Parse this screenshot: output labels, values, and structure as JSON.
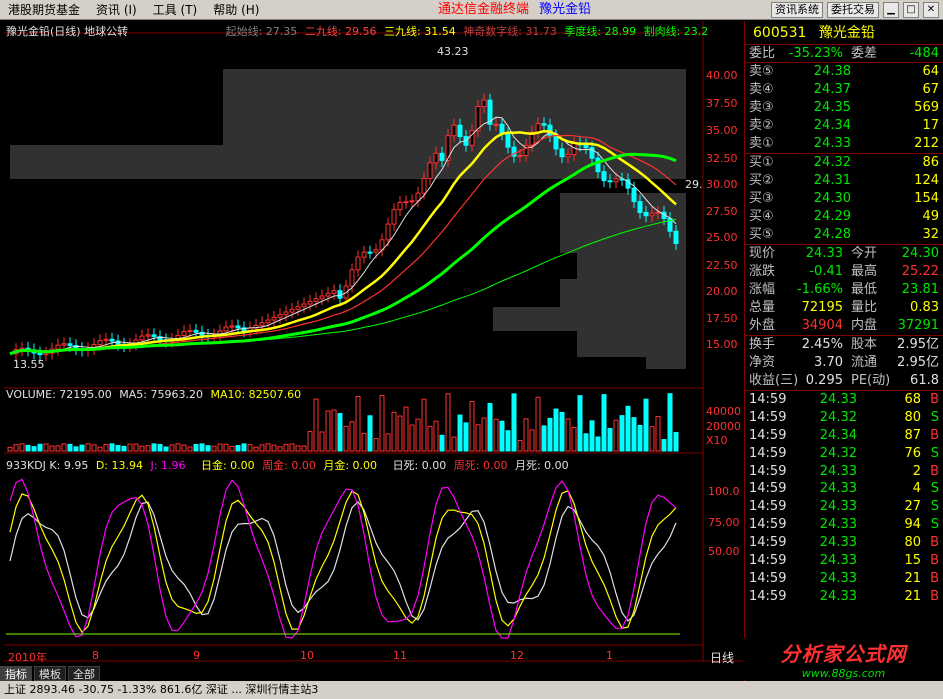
{
  "menu": {
    "items": [
      {
        "label": "港股期货基金"
      },
      {
        "label": "资讯 (I)"
      },
      {
        "label": "工具 (T)"
      },
      {
        "label": "帮助 (H)"
      }
    ],
    "center_title": "通达信金融终端",
    "center_stock": "豫光金铅",
    "buttons": [
      "资讯系统",
      "委托交易"
    ]
  },
  "chart_header": {
    "title": "豫光金铅(日线) 地球公转",
    "lines": [
      {
        "label": "起始线: 27.35",
        "color": "#808080"
      },
      {
        "label": "二九线: 29.56",
        "color": "#ff4040"
      },
      {
        "label": "三九线: 31.54",
        "color": "#ffff00"
      },
      {
        "label": "神奇数字线: 31.73",
        "color": "#c04040"
      },
      {
        "label": "季度线: 28.99",
        "color": "#00ff00"
      },
      {
        "label": "割肉线: 23.2",
        "color": "#00ff00"
      }
    ]
  },
  "price_axis": [
    "40.00",
    "37.50",
    "35.00",
    "32.50",
    "30.00",
    "27.50",
    "25.00",
    "22.50",
    "20.00",
    "17.50",
    "15.00"
  ],
  "price_markers": {
    "high": "43.23",
    "low": "13.55",
    "last": "29."
  },
  "volume_header": {
    "label": "VOLUME: 72195.00",
    "ma5": "MA5: 75963.20",
    "ma10": "MA10: 82507.60"
  },
  "volume_axis": [
    "40000",
    "20000",
    "X10"
  ],
  "kdj_header": {
    "label": "933KDJ K: 9.95",
    "d": "D: 13.94",
    "j": "J: 1.96",
    "extras": [
      "日金: 0.00",
      "周金: 0.00",
      "月金: 0.00",
      "日死: 0.00",
      "周死: 0.00",
      "月死: 0.00"
    ]
  },
  "kdj_axis": [
    "100.0",
    "75.00",
    "50.00"
  ],
  "date_axis": [
    "2010年",
    "8",
    "9",
    "10",
    "11",
    "12",
    "1"
  ],
  "period_label": "日线",
  "bottom_tabs": [
    "指标",
    "模板",
    "全部"
  ],
  "status_text": "上证 2893.46 -30.75 -1.33%   861.6亿 深证 ...   深圳行情主站3",
  "quote": {
    "code": "600531",
    "name": "豫光金铅",
    "weibi": {
      "label": "委比",
      "value": "-35.23%",
      "label2": "委差",
      "value2": "-484"
    },
    "asks": [
      {
        "label": "卖⑤",
        "price": "24.38",
        "vol": "64"
      },
      {
        "label": "卖④",
        "price": "24.37",
        "vol": "67"
      },
      {
        "label": "卖③",
        "price": "24.35",
        "vol": "569"
      },
      {
        "label": "卖②",
        "price": "24.34",
        "vol": "17"
      },
      {
        "label": "卖①",
        "price": "24.33",
        "vol": "212"
      }
    ],
    "bids": [
      {
        "label": "买①",
        "price": "24.32",
        "vol": "86"
      },
      {
        "label": "买②",
        "price": "24.31",
        "vol": "124"
      },
      {
        "label": "买③",
        "price": "24.30",
        "vol": "154"
      },
      {
        "label": "买④",
        "price": "24.29",
        "vol": "49"
      },
      {
        "label": "买⑤",
        "price": "24.28",
        "vol": "32"
      }
    ],
    "stats": [
      {
        "l1": "现价",
        "v1": "24.33",
        "c1": "g",
        "l2": "今开",
        "v2": "24.30",
        "c2": "g"
      },
      {
        "l1": "涨跌",
        "v1": "-0.41",
        "c1": "g",
        "l2": "最高",
        "v2": "25.22",
        "c2": "r"
      },
      {
        "l1": "涨幅",
        "v1": "-1.66%",
        "c1": "g",
        "l2": "最低",
        "v2": "23.81",
        "c2": "g"
      },
      {
        "l1": "总量",
        "v1": "72195",
        "c1": "y",
        "l2": "量比",
        "v2": "0.83",
        "c2": "y"
      },
      {
        "l1": "外盘",
        "v1": "34904",
        "c1": "r",
        "l2": "内盘",
        "v2": "37291",
        "c2": "g"
      }
    ],
    "stats2": [
      {
        "l1": "换手",
        "v1": "2.45%",
        "l2": "股本",
        "v2": "2.95亿"
      },
      {
        "l1": "净资",
        "v1": "3.70",
        "l2": "流通",
        "v2": "2.95亿"
      },
      {
        "l1": "收益(三)",
        "v1": "0.295",
        "l2": "PE(动)",
        "v2": "61.8"
      }
    ],
    "ticks": [
      {
        "time": "14:59",
        "price": "24.33",
        "vol": "68",
        "side": "B"
      },
      {
        "time": "14:59",
        "price": "24.32",
        "vol": "80",
        "side": "S"
      },
      {
        "time": "14:59",
        "price": "24.34",
        "vol": "87",
        "side": "B"
      },
      {
        "time": "14:59",
        "price": "24.32",
        "vol": "76",
        "side": "S"
      },
      {
        "time": "14:59",
        "price": "24.33",
        "vol": "2",
        "side": "B"
      },
      {
        "time": "14:59",
        "price": "24.33",
        "vol": "4",
        "side": "S"
      },
      {
        "time": "14:59",
        "price": "24.33",
        "vol": "27",
        "side": "S"
      },
      {
        "time": "14:59",
        "price": "24.33",
        "vol": "94",
        "side": "S"
      },
      {
        "time": "14:59",
        "price": "24.33",
        "vol": "80",
        "side": "B"
      },
      {
        "time": "14:59",
        "price": "24.33",
        "vol": "15",
        "side": "B"
      },
      {
        "time": "14:59",
        "price": "24.33",
        "vol": "21",
        "side": "B"
      },
      {
        "time": "14:59",
        "price": "24.33",
        "vol": "21",
        "side": "B"
      }
    ]
  },
  "logo": {
    "main": "分析家公式网",
    "sub": "www.88gs.com"
  },
  "colors": {
    "up": "#ff3030",
    "down": "#00ffff",
    "ma_yellow": "#ffff00",
    "ma_green": "#00ff00",
    "grid": "#800000"
  }
}
